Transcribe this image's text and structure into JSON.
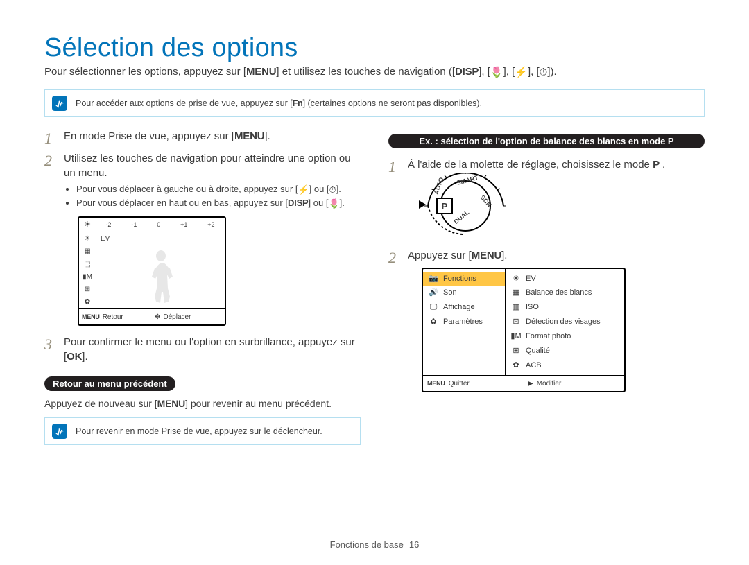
{
  "title": "Sélection des options",
  "intro_1": "Pour sélectionner les options, appuyez sur [",
  "intro_menu": "MENU",
  "intro_2": "] et utilisez les touches de navigation ([",
  "intro_disp": "DISP",
  "intro_3": "], [",
  "intro_icon_macro": "🌷",
  "intro_4": "], [",
  "intro_icon_flash": "⚡",
  "intro_5": "], [",
  "intro_icon_timer": "⏱",
  "intro_6": "]).",
  "info1_a": "Pour accéder aux options de prise de vue, appuyez sur [",
  "info1_fn": "Fn",
  "info1_b": "] (certaines options ne seront pas disponibles).",
  "left": {
    "step1_a": "En mode Prise de vue, appuyez sur [",
    "step1_menu": "MENU",
    "step1_b": "].",
    "step2": "Utilisez les touches de navigation pour atteindre une option ou un menu.",
    "b1_a": "Pour vous déplacer à gauche ou à droite, appuyez sur [",
    "b1_icon1": "⚡",
    "b1_mid": "] ou [",
    "b1_icon2": "⏱",
    "b1_b": "].",
    "b2_a": "Pour vous déplacer en haut ou en bas, appuyez sur [",
    "b2_disp": "DISP",
    "b2_mid": "] ou [",
    "b2_icon": "🌷",
    "b2_b": "].",
    "step3_a": "Pour confirmer le menu ou l'option en surbrillance, appuyez sur [",
    "step3_ok": "OK",
    "step3_b": "].",
    "pill": "Retour au menu précédent",
    "note_a": "Appuyez de nouveau sur [",
    "note_menu": "MENU",
    "note_b": "] pour revenir au menu précédent.",
    "info2": "Pour revenir en mode Prise de vue, appuyez sur le déclencheur.",
    "screen": {
      "ev_ticks": [
        "-2",
        "-1",
        "0",
        "+1",
        "+2"
      ],
      "ev_label": "EV",
      "side_icons": [
        "☀",
        "▦",
        "⬚",
        "▮M",
        "⊞",
        "✿"
      ],
      "bot_menu": "MENU",
      "bot_retour": "Retour",
      "bot_nav": "✥",
      "bot_deplacer": "Déplacer"
    }
  },
  "right": {
    "pill": "Ex. : sélection de l'option de balance des blancs en mode P",
    "step1_a": "À l'aide de la molette de réglage, choisissez le mode ",
    "step1_p": "P",
    "step1_b": " .",
    "dial": {
      "p": "P",
      "auto": "AUTO",
      "smart": "SMART",
      "scn": "SCN",
      "dual": "DUAL"
    },
    "step2_a": "Appuyez sur [",
    "step2_menu": "MENU",
    "step2_b": "].",
    "screen": {
      "left_items": [
        {
          "icon": "📷",
          "label": "Fonctions",
          "hl": true
        },
        {
          "icon": "🔊",
          "label": "Son"
        },
        {
          "icon": "🖵",
          "label": "Affichage"
        },
        {
          "icon": "✿",
          "label": "Paramètres"
        }
      ],
      "right_items": [
        {
          "icon": "☀",
          "label": "EV"
        },
        {
          "icon": "▦",
          "label": "Balance des blancs"
        },
        {
          "icon": "▥",
          "label": "ISO"
        },
        {
          "icon": "⊡",
          "label": "Détection des visages"
        },
        {
          "icon": "▮M",
          "label": "Format photo"
        },
        {
          "icon": "⊞",
          "label": "Qualité"
        },
        {
          "icon": "✿",
          "label": "ACB"
        }
      ],
      "bot_menu": "MENU",
      "bot_quitter": "Quitter",
      "bot_arrow": "▶",
      "bot_modifier": "Modifier"
    }
  },
  "footer": {
    "label": "Fonctions de base",
    "page": "16"
  }
}
